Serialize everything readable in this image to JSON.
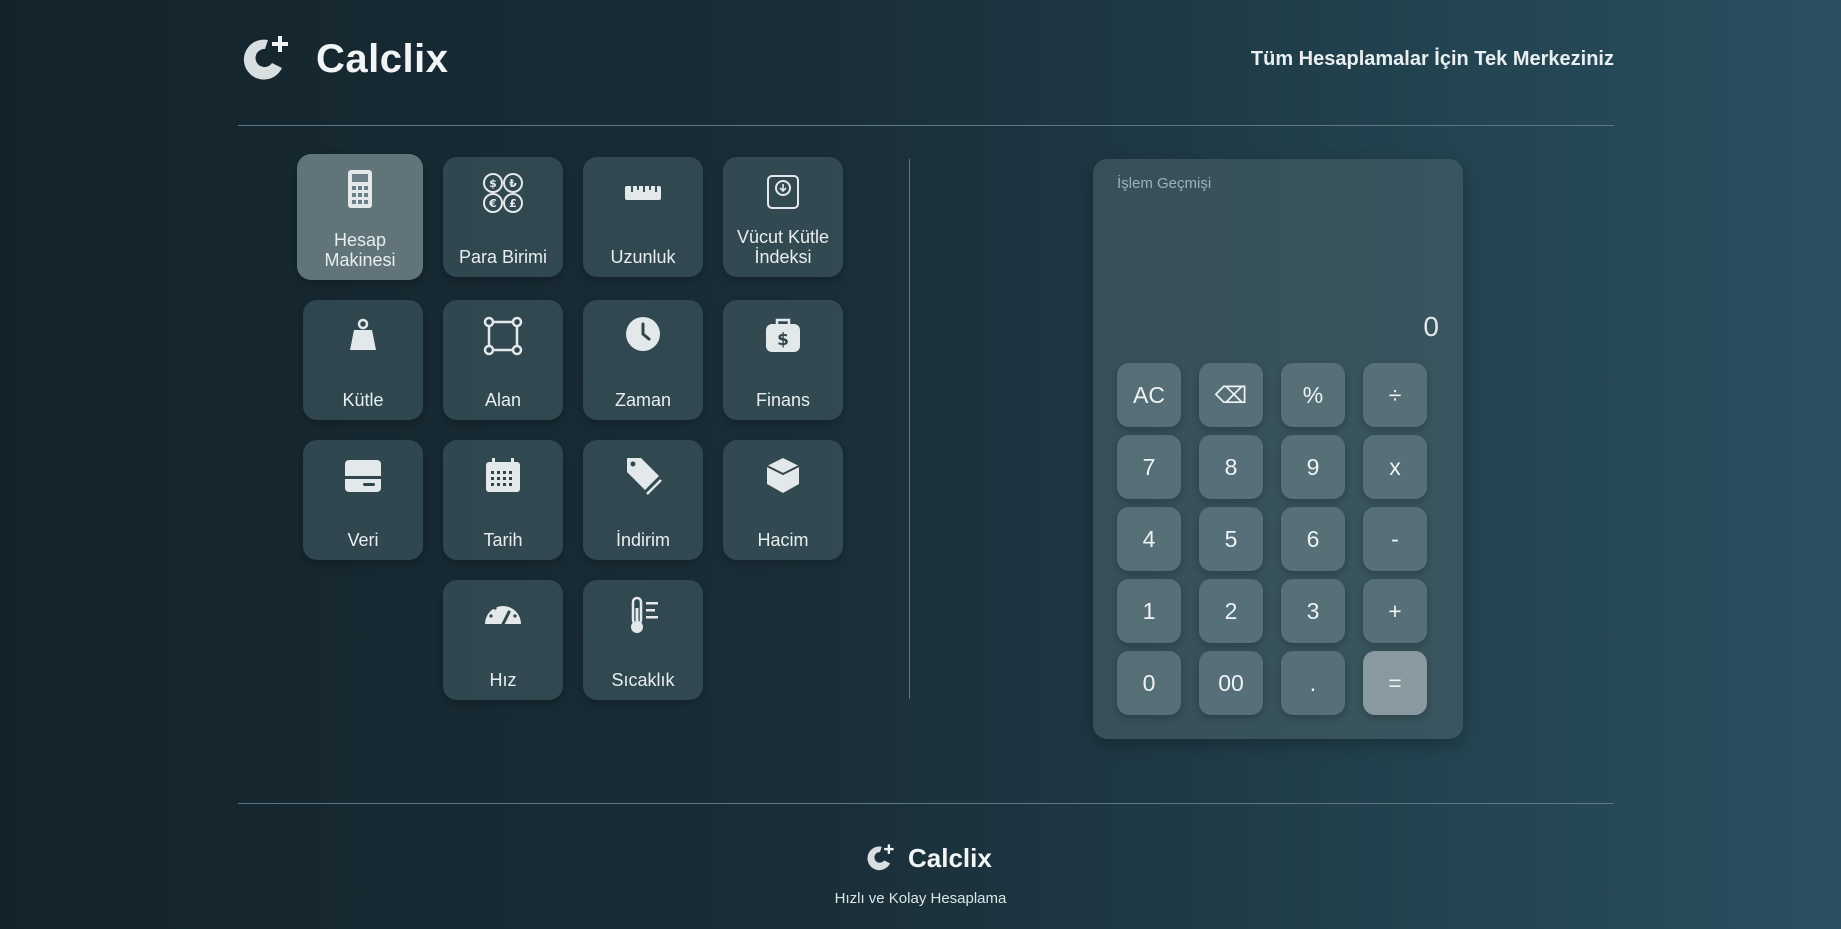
{
  "brand": {
    "name": "Calclix",
    "tagline": "Tüm Hesaplamalar İçin Tek Merkeziniz"
  },
  "categories": [
    {
      "label": "Hesap Makinesi",
      "icon": "calculator-icon",
      "active": true
    },
    {
      "label": "Para Birimi",
      "icon": "currency-icon"
    },
    {
      "label": "Uzunluk",
      "icon": "ruler-icon"
    },
    {
      "label": "Vücut Kütle İndeksi",
      "icon": "bmi-scale-icon"
    },
    {
      "label": "Kütle",
      "icon": "weight-icon"
    },
    {
      "label": "Alan",
      "icon": "area-icon"
    },
    {
      "label": "Zaman",
      "icon": "clock-icon"
    },
    {
      "label": "Finans",
      "icon": "money-bag-icon"
    },
    {
      "label": "Veri",
      "icon": "hard-drive-icon"
    },
    {
      "label": "Tarih",
      "icon": "calendar-icon"
    },
    {
      "label": "İndirim",
      "icon": "tags-icon"
    },
    {
      "label": "Hacim",
      "icon": "cube-icon"
    },
    {
      "label": "Hız",
      "icon": "speedometer-icon"
    },
    {
      "label": "Sıcaklık",
      "icon": "thermometer-icon"
    }
  ],
  "calculator": {
    "history_label": "İşlem Geçmişi",
    "display": "0",
    "keys": [
      [
        "AC",
        "⌫",
        "%",
        "÷"
      ],
      [
        "7",
        "8",
        "9",
        "x"
      ],
      [
        "4",
        "5",
        "6",
        "-"
      ],
      [
        "1",
        "2",
        "3",
        "+"
      ],
      [
        "0",
        "00",
        ".",
        "="
      ]
    ]
  },
  "footer": {
    "name": "Calclix",
    "subtitle": "Hızlı ve Kolay Hesaplama"
  }
}
